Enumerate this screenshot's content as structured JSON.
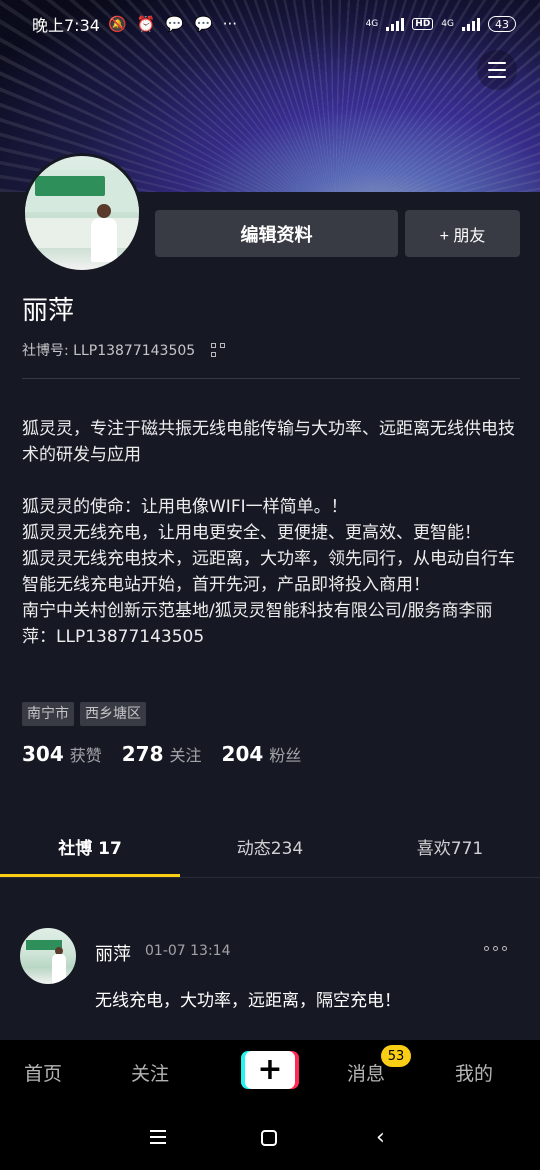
{
  "status_bar": {
    "time": "晚上7:34",
    "network1": "4G",
    "hd": "HD",
    "network2": "4G",
    "battery": "43"
  },
  "profile": {
    "name": "丽萍",
    "id_label": "社博号: LLP13877143505",
    "edit_button": "编辑资料",
    "friend_button": "+ 朋友",
    "bio": "狐灵灵，专注于磁共振无线电能传输与大功率、远距离无线供电技术的研发与应用\n\n狐灵灵的使命：让用电像WIFI一样简单。！\n狐灵灵无线充电，让用电更安全、更便捷、更高效、更智能！\n狐灵灵无线充电技术，远距离，大功率，领先同行，从电动自行车智能无线充电站开始，首开先河，产品即将投入商用！\n南宁中关村创新示范基地/狐灵灵智能科技有限公司/服务商李丽萍：LLP13877143505",
    "tags": [
      "南宁市",
      "西乡塘区"
    ],
    "stats": [
      {
        "num": "304",
        "label": "获赞"
      },
      {
        "num": "278",
        "label": "关注"
      },
      {
        "num": "204",
        "label": "粉丝"
      }
    ]
  },
  "tabs": [
    {
      "label": "社博 17",
      "active": true
    },
    {
      "label": "动态234",
      "active": false
    },
    {
      "label": "喜欢771",
      "active": false
    }
  ],
  "post": {
    "author": "丽萍",
    "time": "01-07 13:14",
    "text": "无线充电，大功率，远距离，隔空充电！"
  },
  "bottom_nav": {
    "home": "首页",
    "follow": "关注",
    "messages": "消息",
    "messages_badge": "53",
    "me": "我的"
  },
  "colors": {
    "background": "#161823",
    "button": "#393b44",
    "accent_yellow": "#face15",
    "plus_cyan": "#25f4ee",
    "plus_red": "#fe2c55"
  }
}
